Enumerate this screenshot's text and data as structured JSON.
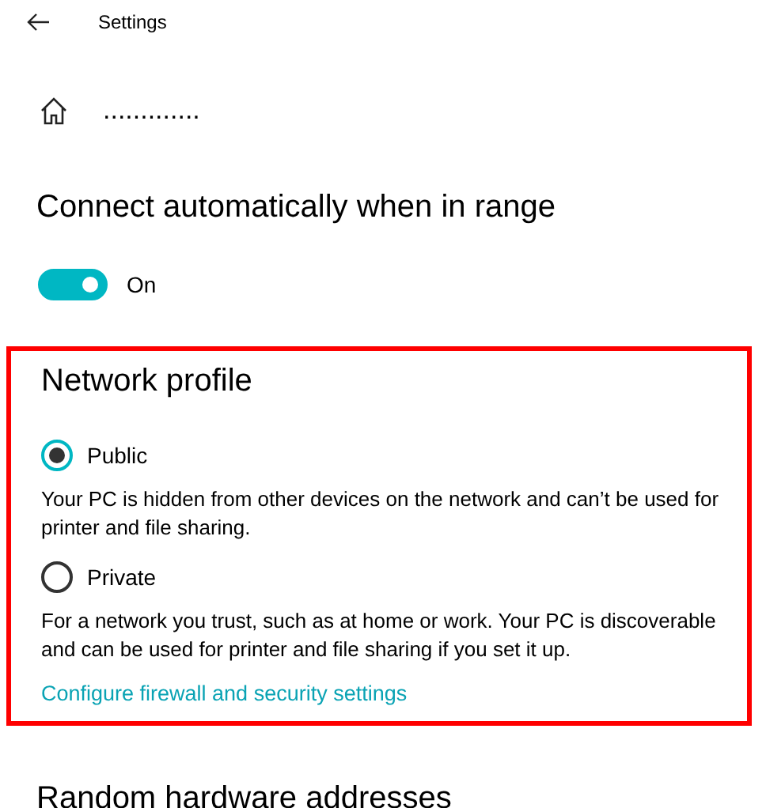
{
  "window": {
    "title": "Settings"
  },
  "page": {
    "title": "............."
  },
  "connect": {
    "heading": "Connect automatically when in range",
    "toggle": {
      "on": true,
      "label": "On"
    }
  },
  "network_profile": {
    "heading": "Network profile",
    "highlighted": true,
    "options": [
      {
        "label": "Public",
        "selected": true,
        "description": "Your PC is hidden from other devices on the network and can’t be used for printer and file sharing."
      },
      {
        "label": "Private",
        "selected": false,
        "description": "For a network you trust, such as at home or work. Your PC is discoverable and can be used for printer and file sharing if you set it up."
      }
    ],
    "link": "Configure firewall and security settings"
  },
  "next_section": {
    "heading": "Random hardware addresses"
  }
}
